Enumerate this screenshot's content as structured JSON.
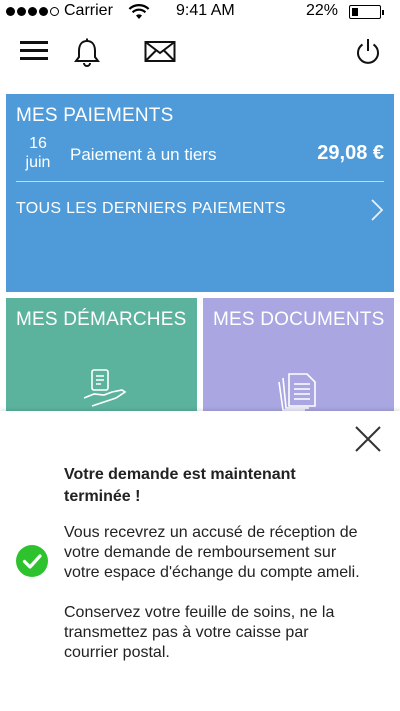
{
  "status_bar": {
    "carrier": "Carrier",
    "time": "9:41 AM",
    "battery": "22%",
    "battery_fraction": 0.22,
    "signal_bars_filled": 4,
    "signal_bars_total": 5
  },
  "nav": {
    "icons": [
      "menu-icon",
      "bell-icon",
      "mail-icon",
      "power-icon"
    ]
  },
  "payments": {
    "title": "MES PAIEMENTS",
    "date_day": "16",
    "date_month": "juin",
    "description": "Paiement à un tiers",
    "amount": "29,08 €",
    "all_link": "TOUS LES DERNIERS PAIEMENTS"
  },
  "tiles": {
    "demarches": "MES DÉMARCHES",
    "documents": "MES DOCUMENTS"
  },
  "sheet": {
    "title": "Votre demande est maintenant terminée !",
    "paragraph1": "Vous recevrez un accusé de réception de votre demande de remboursement sur votre espace d'échange du compte ameli.",
    "paragraph2": "Conservez votre feuille de soins, ne la transmettez pas à votre caisse par courrier postal."
  },
  "colors": {
    "payments_tile": "#4f9bd9",
    "demarches_tile": "#5bb39e",
    "documents_tile": "#a9a6e2",
    "success": "#2ec22e"
  }
}
